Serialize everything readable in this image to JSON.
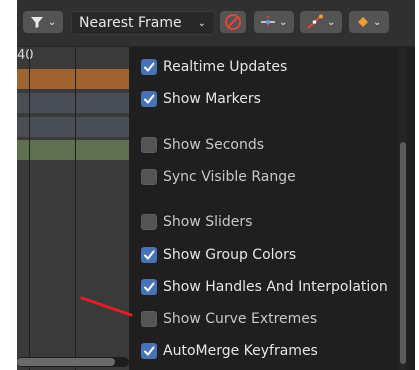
{
  "header": {
    "filter_icon": "filter-icon",
    "interpolation_select": "Nearest Frame",
    "proportional_icon": "proportional-editing-icon",
    "pivot_icon": "pivot-snap-icon",
    "curve_icon": "curve-edit-icon",
    "keyframe_icon": "keyframe-diamond-icon"
  },
  "timeline": {
    "frame_number": "40",
    "track_colors": [
      "#a0622e",
      "#4a4f57",
      "#4a4f57",
      "#5f7051"
    ]
  },
  "menu": {
    "items": [
      {
        "label": "Realtime Updates",
        "checked": true
      },
      {
        "label": "Show Markers",
        "checked": true
      },
      {
        "label": "Show Seconds",
        "checked": false
      },
      {
        "label": "Sync Visible Range",
        "checked": false
      },
      {
        "label": "Show Sliders",
        "checked": false
      },
      {
        "label": "Show Group Colors",
        "checked": true
      },
      {
        "label": "Show Handles And Interpolation",
        "checked": true
      },
      {
        "label": "Show Curve Extremes",
        "checked": false
      },
      {
        "label": "AutoMerge Keyframes",
        "checked": true
      }
    ]
  },
  "colors": {
    "checkbox_on": "#4772b3",
    "annotation_arrow": "#e31f26"
  }
}
